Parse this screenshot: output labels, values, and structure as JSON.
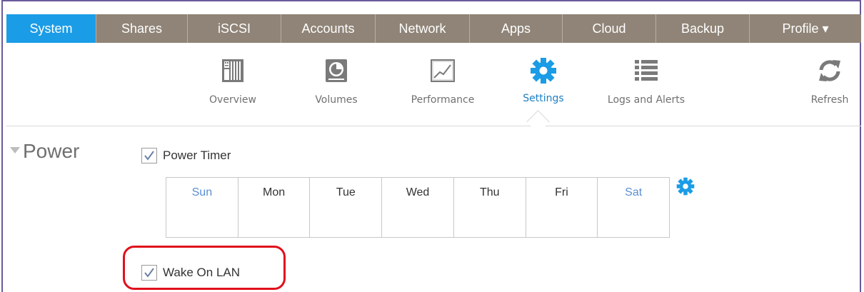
{
  "topnav": {
    "tabs": [
      {
        "label": "System",
        "active": true
      },
      {
        "label": "Shares"
      },
      {
        "label": "iSCSI"
      },
      {
        "label": "Accounts"
      },
      {
        "label": "Network"
      },
      {
        "label": "Apps"
      },
      {
        "label": "Cloud"
      },
      {
        "label": "Backup"
      },
      {
        "label": "Profile ▾"
      }
    ]
  },
  "subnav": {
    "items": [
      {
        "label": "Overview",
        "icon": "drive-bay-icon"
      },
      {
        "label": "Volumes",
        "icon": "disk-icon"
      },
      {
        "label": "Performance",
        "icon": "chart-icon"
      },
      {
        "label": "Settings",
        "icon": "gear-icon",
        "active": true
      },
      {
        "label": "Logs and Alerts",
        "icon": "list-icon"
      }
    ],
    "refresh_label": "Refresh"
  },
  "power": {
    "title": "Power",
    "power_timer_label": "Power Timer",
    "power_timer_checked": true,
    "days": [
      "Sun",
      "Mon",
      "Tue",
      "Wed",
      "Thu",
      "Fri",
      "Sat"
    ],
    "wake_on_lan_label": "Wake On LAN",
    "wake_on_lan_checked": true
  },
  "colors": {
    "accent": "#1b9ce6",
    "nav_bg": "#8f8477",
    "annotation": "#e0101b"
  }
}
